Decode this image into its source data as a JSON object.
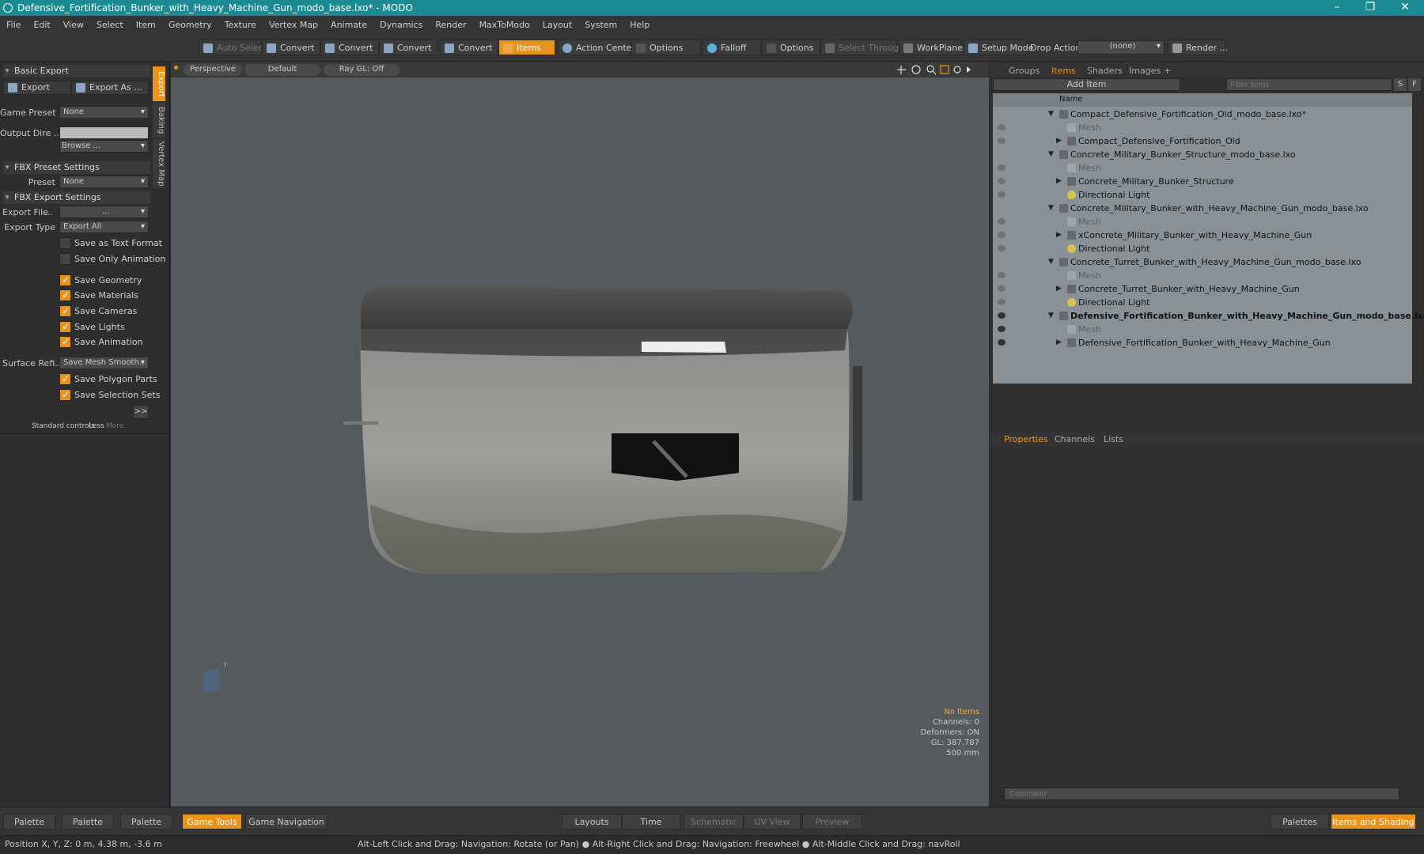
{
  "window": {
    "title": "Defensive_Fortification_Bunker_with_Heavy_Machine_Gun_modo_base.lxo* - MODO",
    "minimize": "–",
    "maximize": "❐",
    "close": "✕"
  },
  "menu": [
    "File",
    "Edit",
    "View",
    "Select",
    "Item",
    "Geometry",
    "Texture",
    "Vertex Map",
    "Animate",
    "Dynamics",
    "Render",
    "MaxToModo",
    "Layout",
    "System",
    "Help"
  ],
  "toolbar": {
    "auto_select": "Auto Select",
    "convert1": "Convert",
    "convert2": "Convert",
    "convert3": "Convert",
    "convert4": "Convert",
    "items": "Items",
    "action_center": "Action Center",
    "options1": "Options",
    "falloff": "Falloff",
    "options2": "Options",
    "select_through": "Select Through",
    "workplane": "WorkPlane",
    "setup_mode": "Setup Mode",
    "drop_action_label": "Drop Action",
    "drop_action_value": "(none)",
    "render": "Render ..."
  },
  "left_panel": {
    "basic_export": "Basic Export",
    "export_btn": "Export",
    "export_as_btn": "Export As ...",
    "game_preset_label": "Game Preset",
    "game_preset_value": "None",
    "output_dir_label": "Output Dire ...",
    "output_dir_value": "",
    "browse": "Browse ...",
    "fbx_preset_settings": "FBX Preset Settings",
    "preset_label": "Preset",
    "preset_value": "None",
    "fbx_export_settings": "FBX Export Settings",
    "export_file_label": "Export File",
    "export_file_value": "...",
    "export_type_label": "Export Type",
    "export_type_value": "Export All",
    "save_text": "Save as Text Format",
    "save_anim_only": "Save Only Animation",
    "save_geometry": "Save Geometry",
    "save_materials": "Save Materials",
    "save_cameras": "Save Cameras",
    "save_lights": "Save Lights",
    "save_animation": "Save Animation",
    "surface_refi_label": "Surface Refi...",
    "surface_refi_value": "Save Mesh Smooth...",
    "save_polygon_parts": "Save Polygon Parts",
    "save_selection_sets": "Save Selection Sets",
    "more_btn": ">>",
    "std_controls": "Standard controls",
    "less": "Less",
    "more": "More",
    "vtab_export": "Export",
    "vtab_baking": "Baking",
    "vtab_vertexmap": "Vertex Map"
  },
  "viewport": {
    "perspective": "Perspective",
    "default": "Default",
    "raygl": "Ray GL: Off",
    "info_no_items": "No Items",
    "info_channels": "Channels: 0",
    "info_deformers": "Deformers: ON",
    "info_gl": "GL: 387,787",
    "info_scale": "500 mm"
  },
  "right_panel": {
    "tab_groups": "Groups",
    "tab_items": "Items",
    "tab_shaders": "Shaders",
    "tab_images": "Images",
    "tab_add": "+",
    "add_item": "Add Item",
    "filter_items": "Filter Items",
    "btn_s": "S",
    "btn_f": "F",
    "col_name": "Name",
    "items": [
      {
        "label": "Compact_Defensive_Fortification_Old_modo_base.lxo*",
        "kind": "scene"
      },
      {
        "label": "Mesh",
        "kind": "mesh"
      },
      {
        "label": "Compact_Defensive_Fortification_Old",
        "kind": "group"
      },
      {
        "label": "Concrete_Military_Bunker_Structure_modo_base.lxo",
        "kind": "scene"
      },
      {
        "label": "Mesh",
        "kind": "mesh"
      },
      {
        "label": "Concrete_Military_Bunker_Structure",
        "kind": "group"
      },
      {
        "label": "Directional Light",
        "kind": "light"
      },
      {
        "label": "Concrete_Military_Bunker_with_Heavy_Machine_Gun_modo_base.lxo",
        "kind": "scene"
      },
      {
        "label": "Mesh",
        "kind": "mesh"
      },
      {
        "label": "xConcrete_Military_Bunker_with_Heavy_Machine_Gun",
        "kind": "group"
      },
      {
        "label": "Directional Light",
        "kind": "light"
      },
      {
        "label": "Concrete_Turret_Bunker_with_Heavy_Machine_Gun_modo_base.lxo",
        "kind": "scene"
      },
      {
        "label": "Mesh",
        "kind": "mesh"
      },
      {
        "label": "Concrete_Turret_Bunker_with_Heavy_Machine_Gun",
        "kind": "group"
      },
      {
        "label": "Directional Light",
        "kind": "light"
      },
      {
        "label": "Defensive_Fortification_Bunker_with_Heavy_Machine_Gun_modo_base.lxo*",
        "kind": "scene-active"
      },
      {
        "label": "Mesh",
        "kind": "mesh"
      },
      {
        "label": "Defensive_Fortification_Bunker_with_Heavy_Machine_Gun",
        "kind": "group"
      }
    ],
    "tab_properties": "Properties",
    "tab_channels": "Channels",
    "tab_lists": "Lists",
    "command_placeholder": "Command"
  },
  "bottom_bar": {
    "palette1": "Palette",
    "palette2": "Palette",
    "palette3": "Palette",
    "game_tools": "Game Tools",
    "game_navigation": "Game Navigation",
    "layouts": "Layouts",
    "time": "Time",
    "schematic": "Schematic",
    "uv_view": "UV View",
    "preview": "Preview",
    "palettes": "Palettes",
    "items_shading": "Items and Shading"
  },
  "status": {
    "position": "Position X, Y, Z:   0 m, 4.38 m, -3.6 m",
    "hint": "Alt-Left Click and Drag: Navigation: Rotate (or Pan) ●  Alt-Right Click and Drag: Navigation: Freewheel ●  Alt-Middle Click and Drag: navRoll"
  }
}
